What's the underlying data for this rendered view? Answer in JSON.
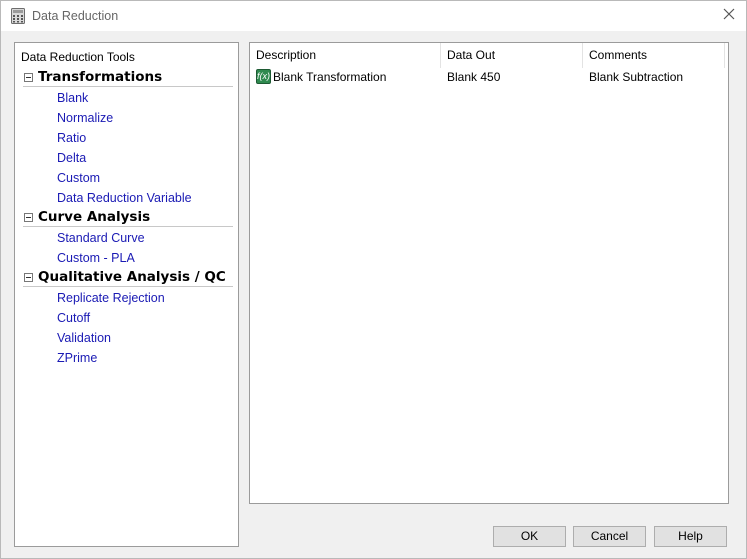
{
  "window": {
    "title": "Data Reduction"
  },
  "tools": {
    "header": "Data Reduction Tools",
    "groups": [
      {
        "title": "Transformations",
        "items": [
          "Blank",
          "Normalize",
          "Ratio",
          "Delta",
          "Custom",
          "Data Reduction Variable"
        ]
      },
      {
        "title": "Curve Analysis",
        "items": [
          "Standard Curve",
          "Custom - PLA"
        ]
      },
      {
        "title": "Qualitative Analysis / QC",
        "items": [
          "Replicate Rejection",
          "Cutoff",
          "Validation",
          "ZPrime"
        ]
      }
    ]
  },
  "table": {
    "columns": [
      "Description",
      "Data Out",
      "Comments"
    ],
    "rows": [
      {
        "icon": "fx-icon",
        "description": "Blank Transformation",
        "data_out": "Blank 450",
        "comments": "Blank Subtraction"
      }
    ]
  },
  "buttons": {
    "ok": "OK",
    "cancel": "Cancel",
    "help": "Help"
  },
  "icons": {
    "title": "calculator-icon",
    "close": "close-icon",
    "toggle": "collapse-minus-icon"
  }
}
